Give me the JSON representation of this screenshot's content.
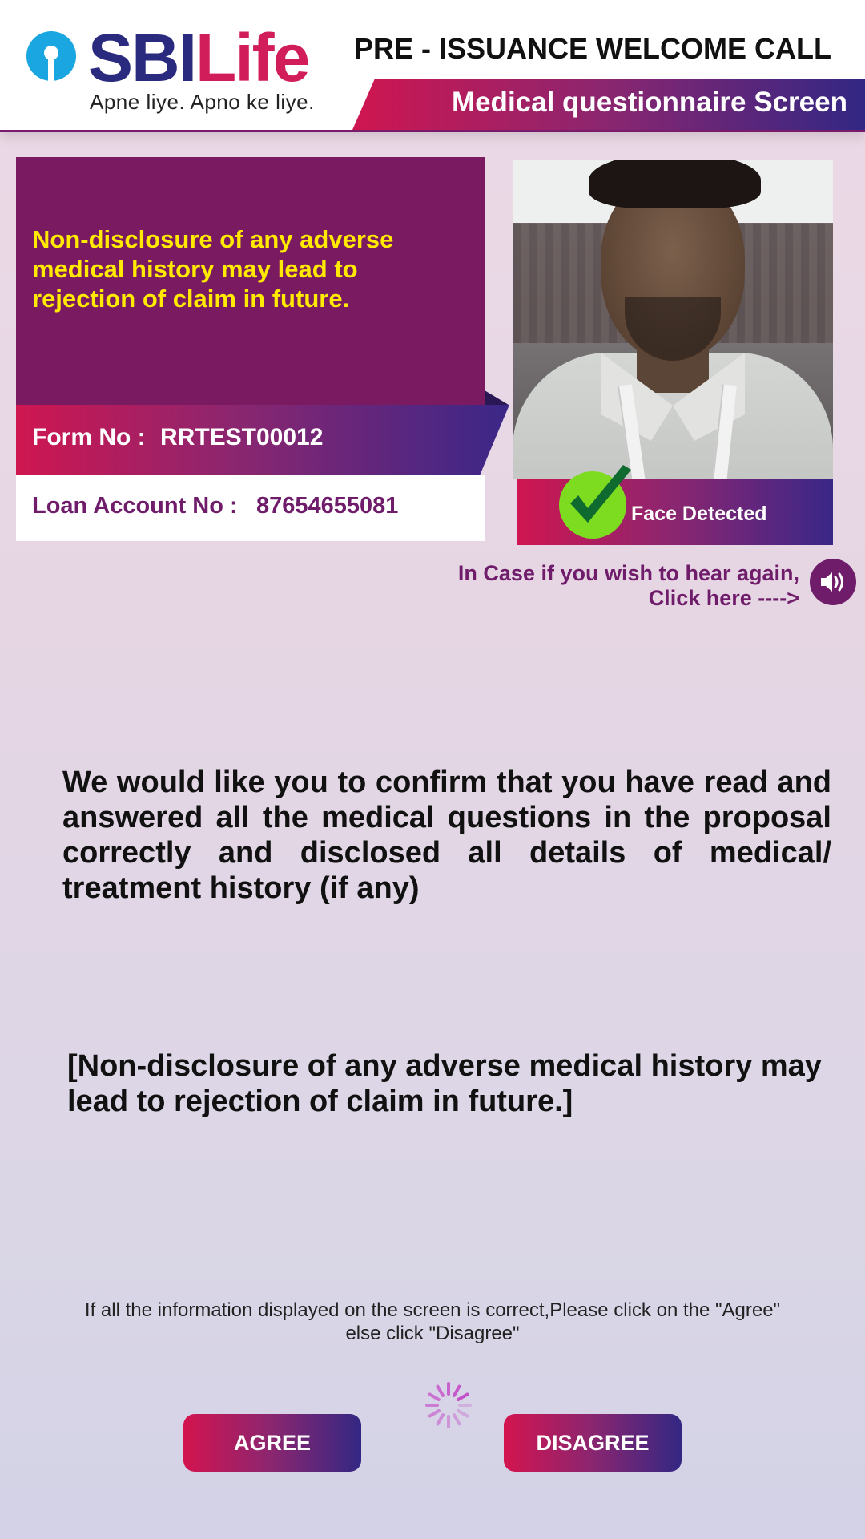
{
  "header": {
    "brand_first": "SBI",
    "brand_second": "Life",
    "tagline": "Apne liye. Apno ke liye.",
    "call_title": "PRE - ISSUANCE WELCOME CALL",
    "screen_title": "Medical questionnaire Screen"
  },
  "info": {
    "warning": "Non-disclosure of any adverse medical history may lead to rejection of claim in future.",
    "form_label": "Form No :",
    "form_value": "RRTEST00012",
    "loan_label": "Loan Account No :",
    "loan_value": "87654655081"
  },
  "camera": {
    "status": "Face Detected",
    "status_icon": "check-icon"
  },
  "replay": {
    "line1": "In Case if you wish to hear again,",
    "line2": "Click here ---->",
    "icon": "speaker-icon"
  },
  "content": {
    "confirmation": "We  would like you to confirm that you have read and answered all the medical questions in the proposal correctly and disclosed all details of medical/ treatment history (if any)",
    "note": "[Non-disclosure  of any adverse medical history may lead to rejection of claim in future.]",
    "instruction_line1": "If all the information displayed on the screen is correct,Please click on the \"Agree\"",
    "instruction_line2": "else click \"Disagree\""
  },
  "buttons": {
    "agree": "AGREE",
    "disagree": "DISAGREE"
  },
  "colors": {
    "brand_blue": "#2a2a7e",
    "brand_pink": "#d11d5a",
    "panel_purple": "#7a1a60",
    "warning_yellow": "#ffea00",
    "accent_text": "#6f1d6b",
    "check_green": "#7ddc1f"
  }
}
